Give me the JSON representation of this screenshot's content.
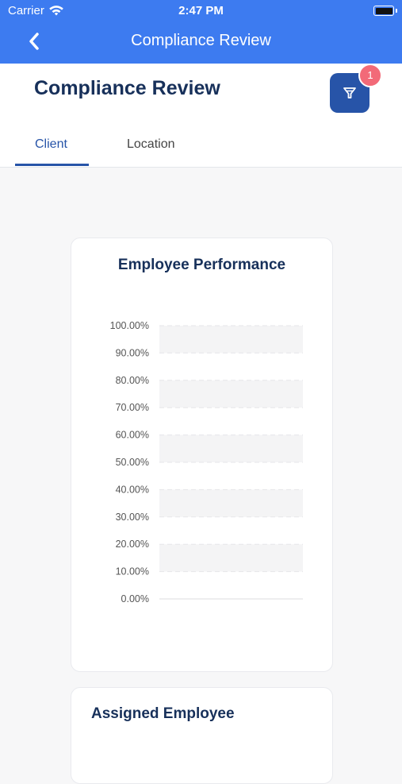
{
  "status_bar": {
    "carrier": "Carrier",
    "time": "2:47 PM"
  },
  "nav": {
    "title": "Compliance Review",
    "back_icon": "chevron-left-icon"
  },
  "header": {
    "title": "Compliance Review",
    "filter_icon": "funnel-icon",
    "filter_badge": "1"
  },
  "tabs": [
    {
      "label": "Client",
      "active": true
    },
    {
      "label": "Location",
      "active": false
    }
  ],
  "colors": {
    "primary": "#3d7bf0",
    "accent": "#2754a8",
    "title": "#17305a",
    "badge": "#f26a78"
  },
  "performance_card": {
    "title": "Employee Performance"
  },
  "chart_data": {
    "type": "bar",
    "title": "Employee Performance",
    "categories": [],
    "series": [],
    "ylim": [
      0,
      100
    ],
    "y_ticks": [
      "100.00%",
      "90.00%",
      "80.00%",
      "70.00%",
      "60.00%",
      "50.00%",
      "40.00%",
      "30.00%",
      "20.00%",
      "10.00%",
      "0.00%"
    ],
    "grid": true
  },
  "assigned_card": {
    "title": "Assigned Employee"
  }
}
